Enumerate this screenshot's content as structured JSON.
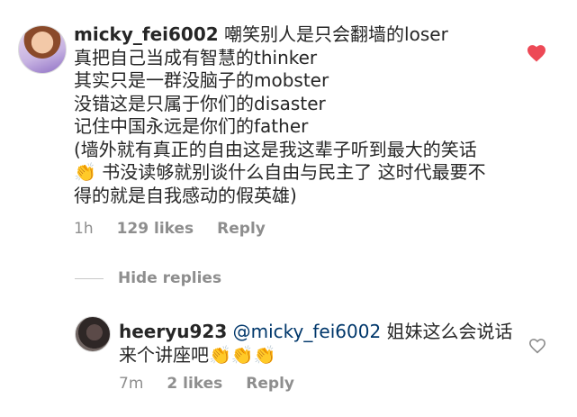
{
  "comment": {
    "username": "micky_fei6002",
    "lines": [
      "嘲笑别人是只会翻墙的loser",
      "真把自己当成有智慧的thinker",
      "其实只是一群没脑子的mobster",
      "没错这是只属于你们的disaster",
      "记住中国永远是你们的father",
      "(墙外就有真正的自由这是我这辈子听到最大的笑话",
      "👏 书没读够就别谈什么自由与民主了 这时代最要不",
      "得的就是自我感动的假英雄)"
    ],
    "time": "1h",
    "likes": "129 likes",
    "reply_label": "Reply",
    "liked": true,
    "heart_color": "#ed4956"
  },
  "hide_replies_label": "Hide replies",
  "reply": {
    "username": "heeryu923",
    "mention": "@micky_fei6002",
    "text_after_mention": " 姐妹这么会说话",
    "text_line2": "来个讲座吧👏👏👏",
    "time": "7m",
    "likes": "2 likes",
    "reply_label": "Reply",
    "liked": false
  }
}
